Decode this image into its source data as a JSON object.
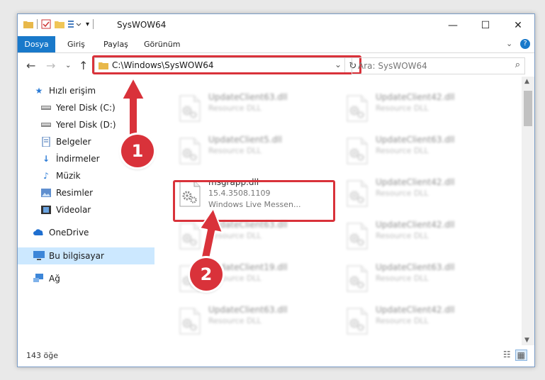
{
  "window": {
    "title": "SysWOW64",
    "minimize_label": "—",
    "maximize_label": "☐",
    "close_label": "✕"
  },
  "ribbon": {
    "tabs": [
      "Dosya",
      "Giriş",
      "Paylaş",
      "Görünüm"
    ]
  },
  "address": {
    "path": "C:\\Windows\\SysWOW64",
    "search_placeholder": "Ara: SysWOW64"
  },
  "sidebar": {
    "items": [
      {
        "label": "Hızlı erişim",
        "icon": "star-icon"
      },
      {
        "label": "Yerel Disk (C:)",
        "icon": "drive-icon"
      },
      {
        "label": "Yerel Disk (D:)",
        "icon": "drive-icon"
      },
      {
        "label": "Belgeler",
        "icon": "document-icon"
      },
      {
        "label": "İndirmeler",
        "icon": "download-icon"
      },
      {
        "label": "Müzik",
        "icon": "music-icon"
      },
      {
        "label": "Resimler",
        "icon": "picture-icon"
      },
      {
        "label": "Videolar",
        "icon": "video-icon"
      },
      {
        "label": "OneDrive",
        "icon": "cloud-icon"
      },
      {
        "label": "Bu bilgisayar",
        "icon": "computer-icon"
      },
      {
        "label": "Ağ",
        "icon": "network-icon"
      }
    ]
  },
  "files": {
    "left": [
      {
        "name": "UpdateClient63.dll",
        "desc": "Resource DLL"
      },
      {
        "name": "UpdateClient5.dll",
        "desc": "Resource DLL"
      },
      {
        "name": "msgrapp.dll",
        "version": "15.4.3508.1109",
        "desc": "Windows Live Messen..."
      },
      {
        "name": "UpdateClient63.dll",
        "desc": "Resource DLL"
      },
      {
        "name": "UpdateClient19.dll",
        "desc": "Resource DLL"
      },
      {
        "name": "UpdateClient63.dll",
        "desc": "Resource DLL"
      }
    ],
    "right": [
      {
        "name": "UpdateClient42.dll",
        "desc": "Resource DLL"
      },
      {
        "name": "UpdateClient63.dll",
        "desc": "Resource DLL"
      },
      {
        "name": "UpdateClient42.dll",
        "desc": "Resource DLL"
      },
      {
        "name": "UpdateClient42.dll",
        "desc": "Resource DLL"
      },
      {
        "name": "UpdateClient63.dll",
        "desc": "Resource DLL"
      },
      {
        "name": "UpdateClient42.dll",
        "desc": "Resource DLL"
      }
    ]
  },
  "status": {
    "count": "143 öğe"
  },
  "annotations": {
    "step1": "1",
    "step2": "2"
  },
  "colors": {
    "accent": "#1979ca",
    "highlight": "#d9323a",
    "selected": "#cce8ff"
  }
}
